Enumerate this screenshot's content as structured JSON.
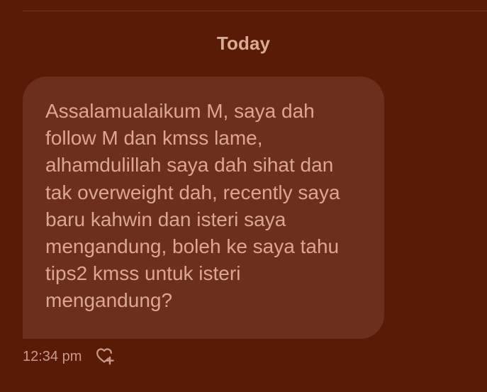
{
  "conversation": {
    "date_separator": "Today"
  },
  "message": {
    "text": "Assalamualaikum M, saya dah follow M dan kmss lame, alhamdulillah saya dah sihat dan tak overweight dah, recently saya baru kahwin dan isteri saya mengandung, boleh ke saya tahu tips2 kmss untuk isteri mengandung?",
    "timestamp": "12:34 pm",
    "reaction_icon": "heart-plus-icon"
  },
  "colors": {
    "background": "#5a1b06",
    "bubble": "#6c2f1e",
    "text": "#dba692",
    "muted_text": "#c9998a"
  }
}
